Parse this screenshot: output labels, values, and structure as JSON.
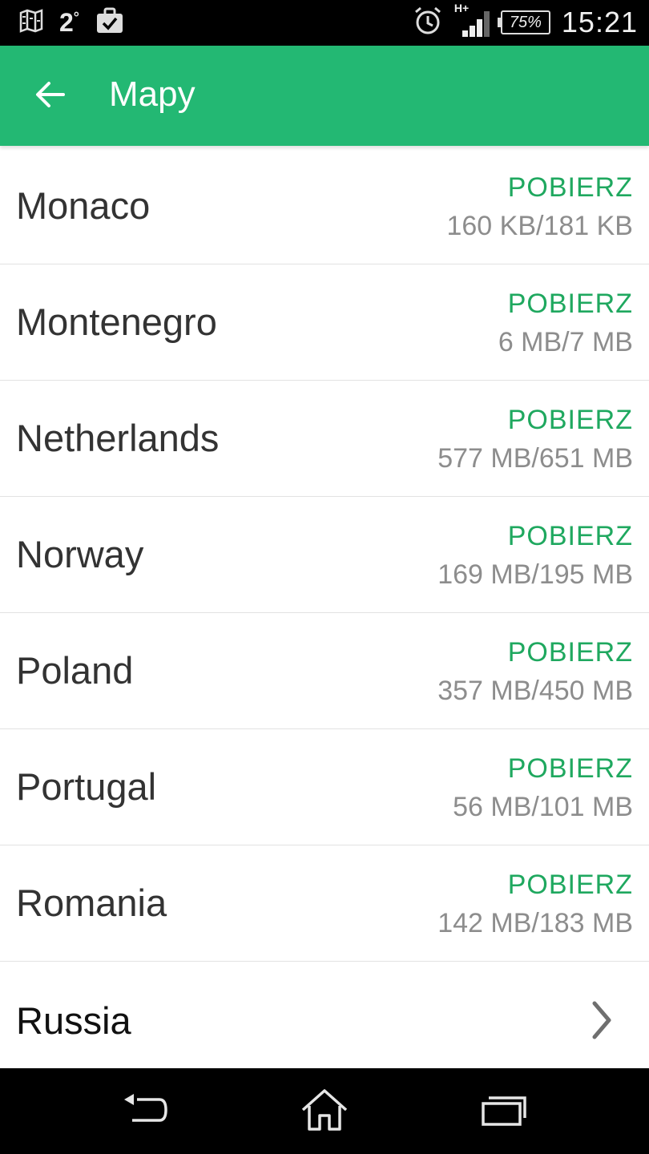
{
  "status_bar": {
    "temperature": "2",
    "temperature_unit": "°",
    "network_type": "H+",
    "battery": "75%",
    "time": "15:21",
    "icons": [
      "map-icon",
      "briefcase-check-icon",
      "alarm-icon",
      "signal-icon",
      "battery-icon"
    ]
  },
  "app_bar": {
    "title": "Mapy",
    "back_icon": "arrow-left-icon",
    "color": "#23b873"
  },
  "countries": [
    {
      "name": "Monaco",
      "action": "POBIERZ",
      "size": "160 KB/181 KB"
    },
    {
      "name": "Montenegro",
      "action": "POBIERZ",
      "size": "6 MB/7 MB"
    },
    {
      "name": "Netherlands",
      "action": "POBIERZ",
      "size": "577 MB/651 MB"
    },
    {
      "name": "Norway",
      "action": "POBIERZ",
      "size": "169 MB/195 MB"
    },
    {
      "name": "Poland",
      "action": "POBIERZ",
      "size": "357 MB/450 MB"
    },
    {
      "name": "Portugal",
      "action": "POBIERZ",
      "size": "56 MB/101 MB"
    },
    {
      "name": "Romania",
      "action": "POBIERZ",
      "size": "142 MB/183 MB"
    }
  ],
  "group_item": {
    "name": "Russia",
    "icon": "chevron-right-icon"
  },
  "nav_bar": {
    "icons": [
      "back-icon",
      "home-icon",
      "recents-icon"
    ]
  },
  "colors": {
    "accent": "#1fa85f",
    "size_text": "#8d8d8d"
  }
}
